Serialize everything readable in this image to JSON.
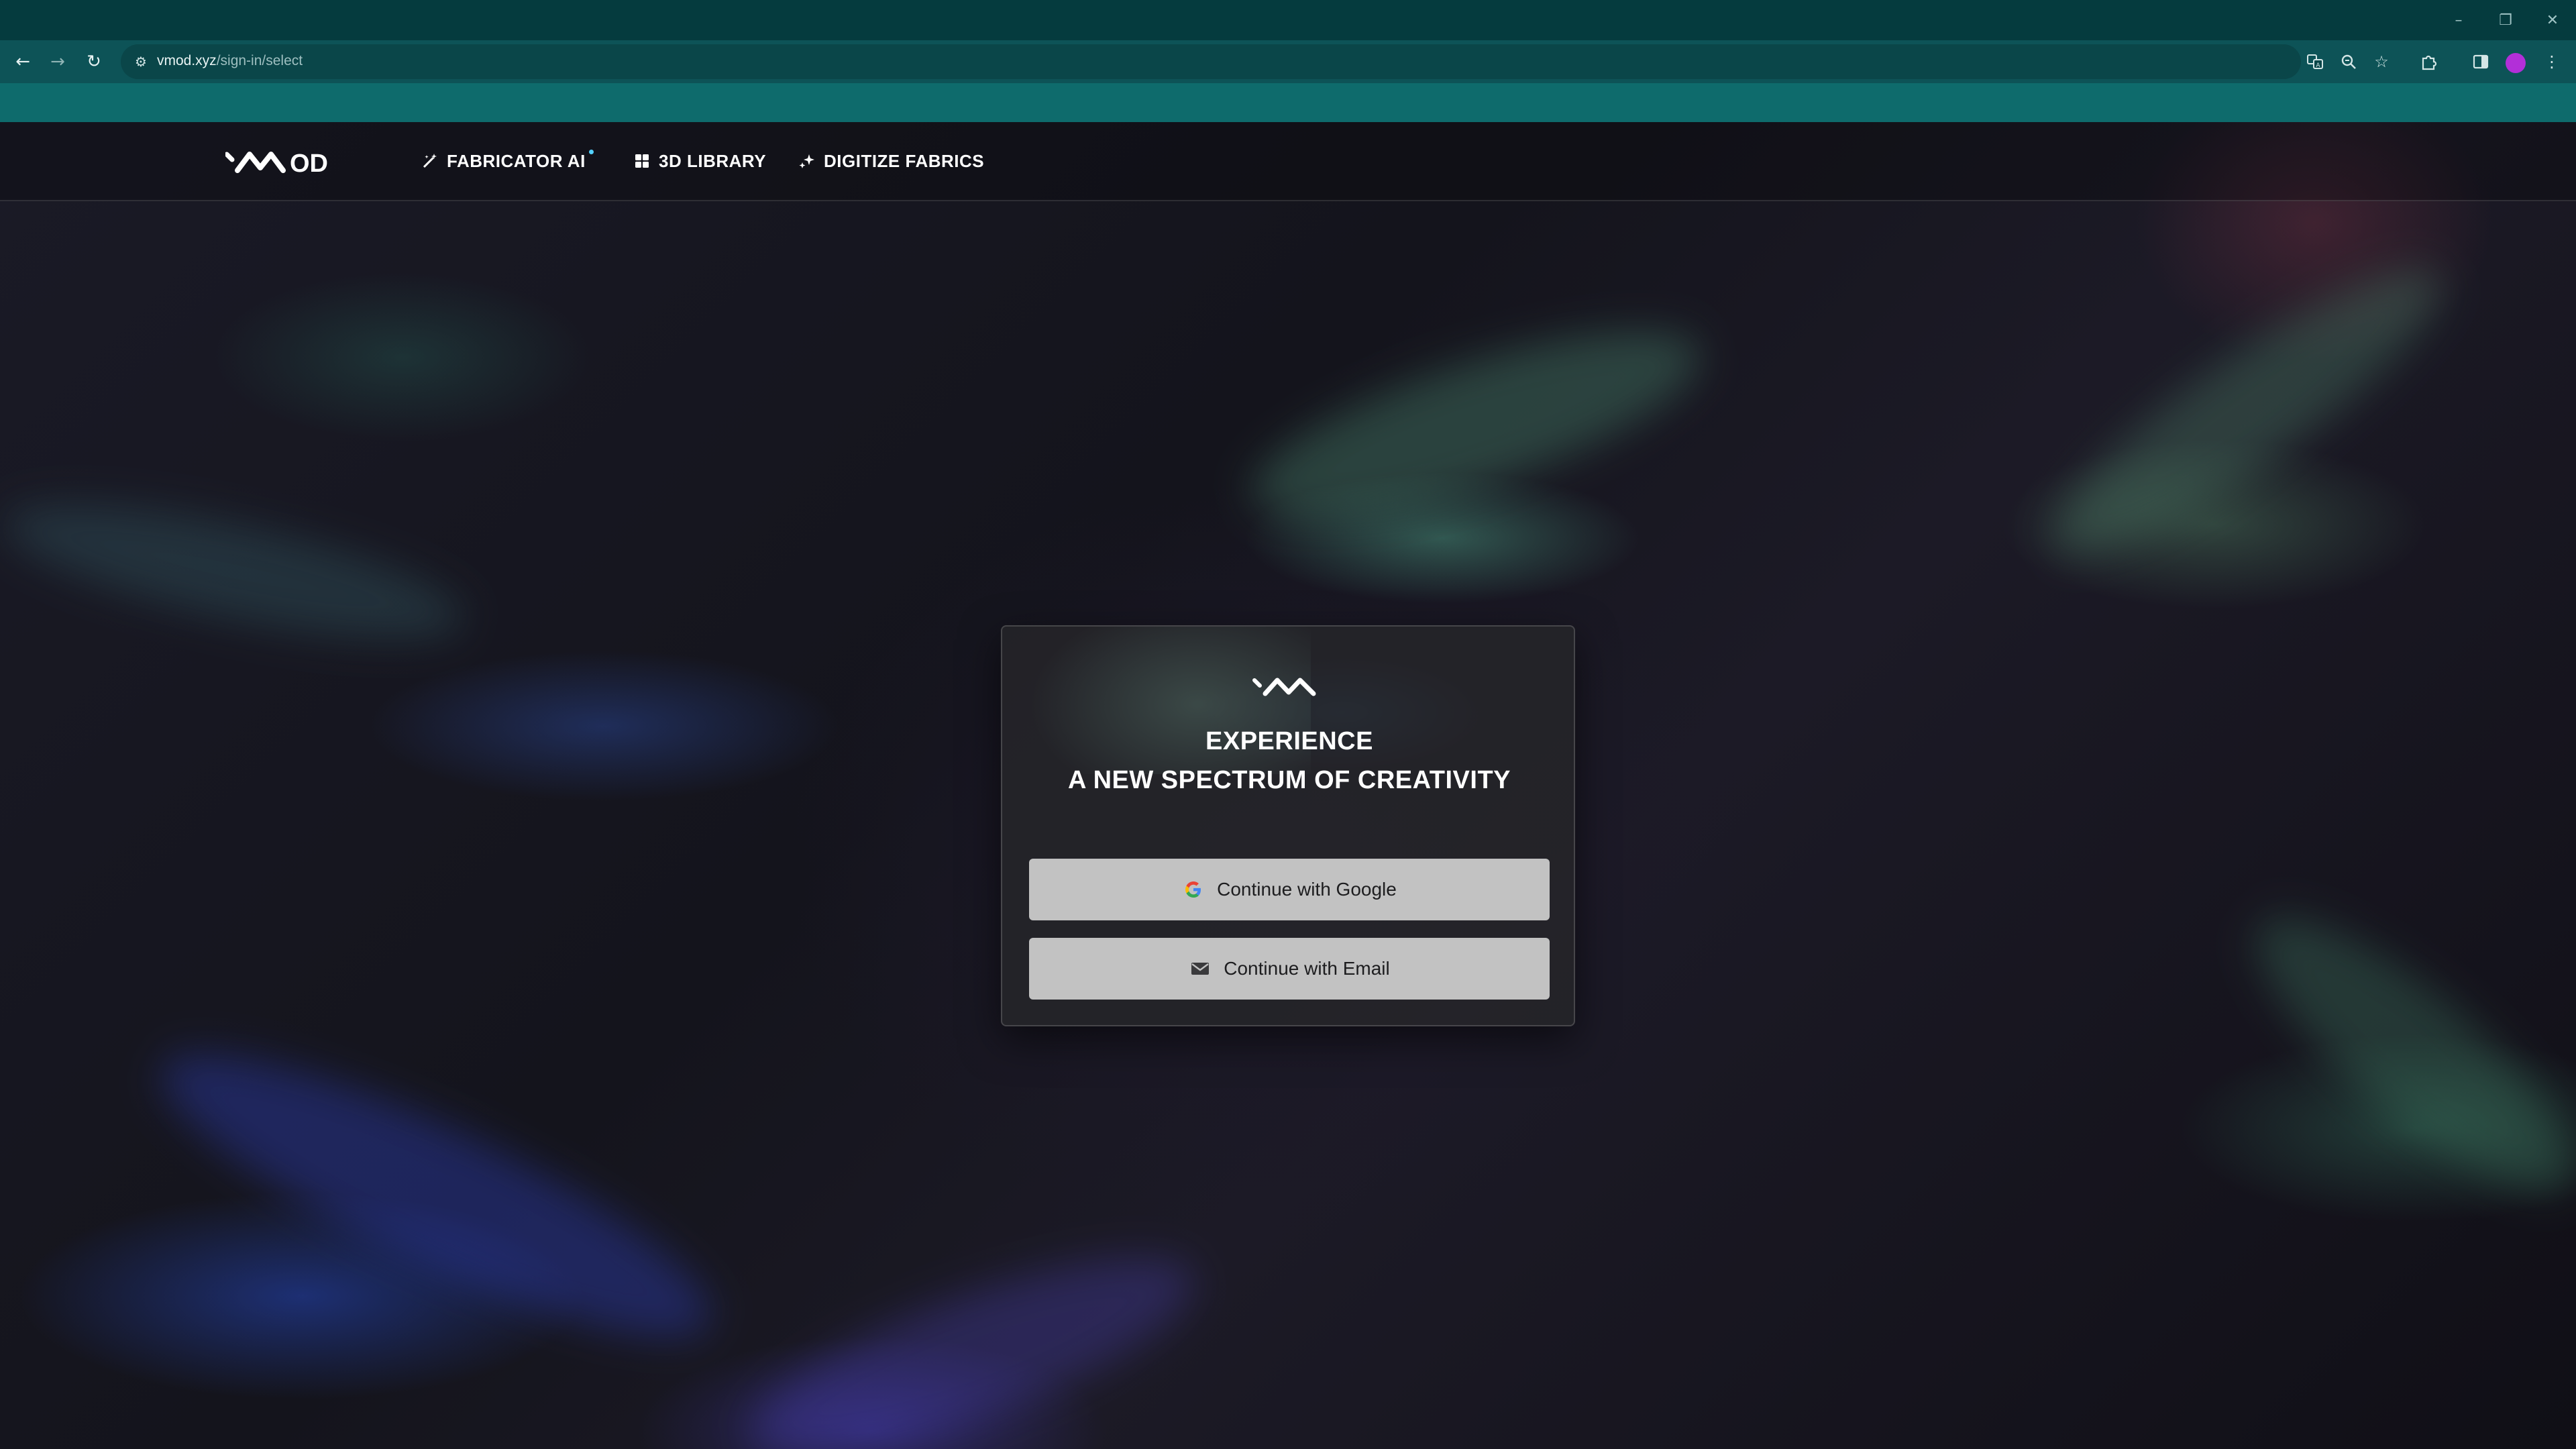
{
  "browser": {
    "url_host": "vmod.xyz",
    "url_path": "/sign-in/select",
    "window_controls": [
      "minimize-icon",
      "restore-icon",
      "close-icon"
    ],
    "nav_icons": [
      "back-arrow-icon",
      "forward-arrow-icon",
      "reload-icon"
    ],
    "omnibox_icons": [
      "translate-icon",
      "zoom-icon",
      "bookmark-star-icon"
    ],
    "toolbar_icons": [
      "extensions-icon",
      "side-panel-icon",
      "menu-icon"
    ],
    "avatar_color": "#b22fd8",
    "theme_colors": {
      "titlebar": "#053b3e",
      "toolbar": "#0d5357",
      "bookmarks_bar": "#0e6b6c"
    }
  },
  "header": {
    "logo_alt": "VMOD",
    "nav": [
      {
        "label": "FABRICATOR AI",
        "icon": "magic-wand-icon",
        "has_new_dot": true
      },
      {
        "label": "3D LIBRARY",
        "icon": "grid-icon",
        "has_new_dot": false
      },
      {
        "label": "DIGITIZE FABRICS",
        "icon": "sparkle-icon",
        "has_new_dot": false
      }
    ]
  },
  "signin_card": {
    "title_line1": "EXPERIENCE",
    "title_line2": "A NEW SPECTRUM OF CREATIVITY",
    "google_button": "Continue with Google",
    "email_button": "Continue with Email",
    "button_bg": "#c2c2c2"
  }
}
